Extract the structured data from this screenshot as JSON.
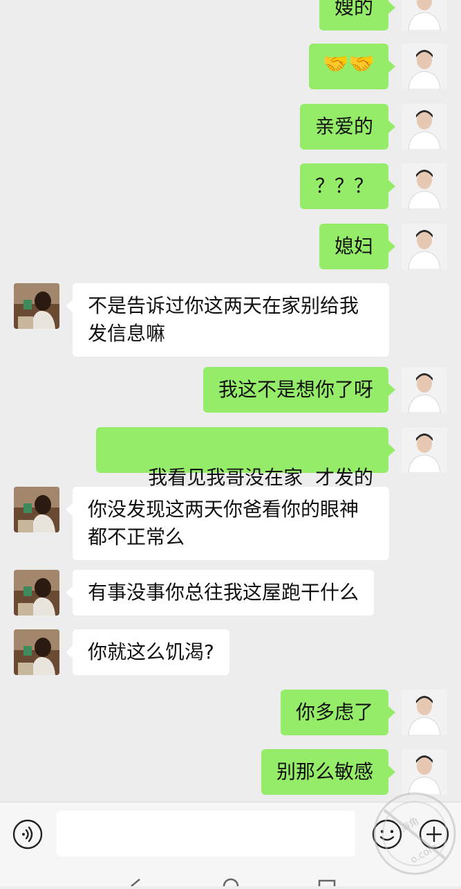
{
  "messages": [
    {
      "sender": "me",
      "text": "嫂的"
    },
    {
      "sender": "me",
      "text": "🤝🤝",
      "type": "emoji"
    },
    {
      "sender": "me",
      "text": "亲爱的"
    },
    {
      "sender": "me",
      "text": "？？？"
    },
    {
      "sender": "me",
      "text": "媳妇"
    },
    {
      "sender": "other",
      "text": "不是告诉过你这两天在家别给我发信息嘛"
    },
    {
      "sender": "me",
      "text": "我这不是想你了呀"
    },
    {
      "sender": "me",
      "text": "我看见我哥没在家  才发的"
    },
    {
      "sender": "other",
      "text": "你没发现这两天你爸看你的眼神都不正常么"
    },
    {
      "sender": "other",
      "text": "有事没事你总往我这屋跑干什么"
    },
    {
      "sender": "other",
      "text": "你就这么饥渴?"
    },
    {
      "sender": "me",
      "text": "你多虑了"
    },
    {
      "sender": "me",
      "text": "别那么敏感"
    }
  ],
  "input_bar": {
    "value": "",
    "voice_icon": "voice-icon",
    "emoji_icon": "emoji-icon",
    "plus_icon": "plus-icon"
  },
  "watermark": {
    "text_top": "海角",
    "text_bottom": "o.com"
  },
  "colors": {
    "background": "#ededed",
    "my_bubble": "#95ec69",
    "other_bubble": "#ffffff"
  }
}
